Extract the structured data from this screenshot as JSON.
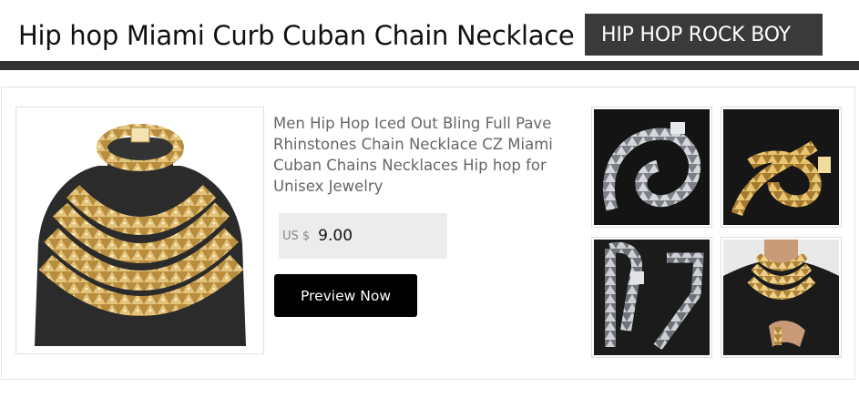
{
  "header": {
    "title": "Hip hop Miami Curb Cuban Chain Necklace",
    "brand": "HIP HOP ROCK BOY"
  },
  "product": {
    "title": "Men Hip Hop Iced Out Bling Full Pave Rhinstones Chain Necklace CZ Miami Cuban Chains Necklaces Hip hop for Unisex Jewelry",
    "currency": "US $",
    "price": "9.00",
    "cta_label": "Preview Now"
  },
  "images": {
    "main": "gold-cuban-chains-on-black-bust",
    "thumbnails": [
      "silver-chain-coiled-on-black",
      "gold-chain-coiled-on-black",
      "silver-chain-and-bracelet-on-black",
      "model-wearing-gold-chains"
    ]
  },
  "colors": {
    "header_bar": "#333333",
    "brand_badge": "#3a3a3a",
    "price_box": "#ececec",
    "button": "#000000",
    "gold": "#c9a45a",
    "silver": "#b9bcc2"
  }
}
